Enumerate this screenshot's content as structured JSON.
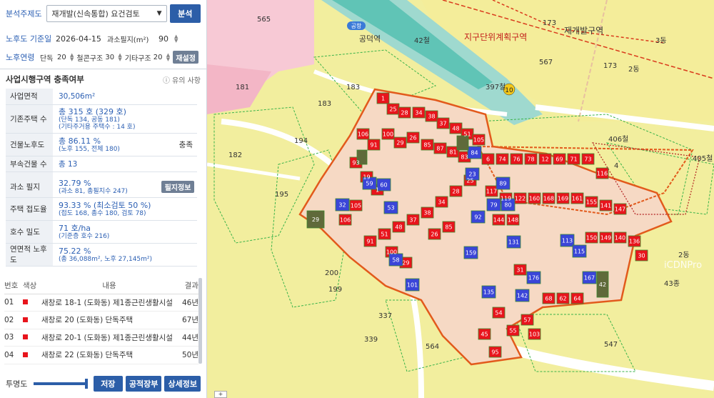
{
  "panel": {
    "topic_label": "분석주제도",
    "topic_select": "재개발(신속통합) 요건검토",
    "analyze_button": "분석",
    "base_date_label": "노후도 기준일",
    "base_date": "2026-04-15",
    "small_parcel_label": "과소필지(m²)",
    "small_parcel_value": "90",
    "age_label": "노후연령",
    "age_single_label": "단독",
    "age_single_value": "20",
    "age_rc_label": "철콘구조",
    "age_rc_value": "30",
    "age_other_label": "기타구조",
    "age_other_value": "20",
    "reanalyze_button": "재설정",
    "section_title": "사업시행구역 충족여부",
    "notes_label": "유의 사항",
    "info": {
      "area_label": "사업면적",
      "area_value": "30,506m²",
      "houses_label": "기존주택 수",
      "houses_value": "총 315 호 (329 호)",
      "houses_sub1": "(단독 134, 공동 181)",
      "houses_sub2": "(기타주거용 주택수 : 14 호)",
      "aging_label": "건물노후도",
      "aging_value": "총 86.11 %",
      "aging_sub": "(노후 155, 전체 180)",
      "aging_status": "충족",
      "annex_label": "부속건물 수",
      "annex_value": "총 13",
      "small_label": "과소 필지",
      "small_value": "32.79 %",
      "small_sub": "(과소 81, 총필지수 247)",
      "small_button": "필지정보",
      "road_label": "주택 접도율",
      "road_value": "93.33 % (최소검토 50 %)",
      "road_sub": "(접도 168, 총수 180, 검토 78)",
      "density_label": "호수 밀도",
      "density_value": "71 호/ha",
      "density_sub": "(기준층 호수 216)",
      "floor_label": "연면적 노후도",
      "floor_value": "75.22 %",
      "floor_sub": "(총 36,088m², 노후 27,145m²)"
    },
    "list_headers": {
      "no": "번호",
      "color": "색상",
      "content": "내용",
      "result": "결과"
    },
    "list_rows": [
      {
        "no": "01",
        "content": "새창로 18-1 (도화동) 제1종근린생활시설",
        "result": "46년"
      },
      {
        "no": "02",
        "content": "새창로 20 (도화동) 단독주택",
        "result": "67년"
      },
      {
        "no": "03",
        "content": "새창로 20-1 (도화동) 제1종근린생활시설",
        "result": "44년"
      },
      {
        "no": "04",
        "content": "새창로 22 (도화동) 단독주택",
        "result": "50년"
      }
    ],
    "opacity_label": "투명도",
    "opacity_value": 0.95,
    "save_button": "저장",
    "ledger_button": "공적장부",
    "detail_button": "상세정보"
  },
  "map": {
    "station_label": "공덕역",
    "station_badge": "공항",
    "district_plan_label": "지구단위계획구역",
    "redev_area_label": "재개발구역",
    "route_badge": "10",
    "labels": [
      "565",
      "173",
      "567",
      "173",
      "2동",
      "3동",
      "181",
      "183",
      "183",
      "194",
      "182",
      "195",
      "200",
      "199",
      "337",
      "339",
      "564",
      "547",
      "397철",
      "406철",
      "405철",
      "42철",
      "43종",
      "4",
      "2동"
    ],
    "watermark": "iCDNPro",
    "red_lots": [
      "1",
      "25",
      "28",
      "34",
      "38",
      "37",
      "48",
      "51",
      "105",
      "106",
      "91",
      "100",
      "29",
      "26",
      "85",
      "87",
      "81",
      "83",
      "6",
      "74",
      "76",
      "78",
      "12",
      "69",
      "71",
      "73",
      "116",
      "117",
      "119",
      "122",
      "160",
      "168",
      "169",
      "161",
      "155",
      "141",
      "147",
      "144",
      "148",
      "150",
      "149",
      "140",
      "136",
      "30",
      "31",
      "68",
      "62",
      "64",
      "57",
      "55",
      "103",
      "54",
      "45",
      "95",
      "93",
      "19"
    ],
    "blue_lots": [
      "59",
      "60",
      "53",
      "84",
      "23",
      "89",
      "79",
      "80",
      "92",
      "131",
      "113",
      "115",
      "159",
      "176",
      "167",
      "142",
      "135",
      "101",
      "58",
      "32"
    ],
    "green_lots": [
      "29",
      "42"
    ]
  },
  "colors": {
    "accent": "#2c5ea8",
    "red_lot": "#e8141c",
    "blue_lot": "#3a45d8",
    "boundary": "#e25a1c"
  }
}
